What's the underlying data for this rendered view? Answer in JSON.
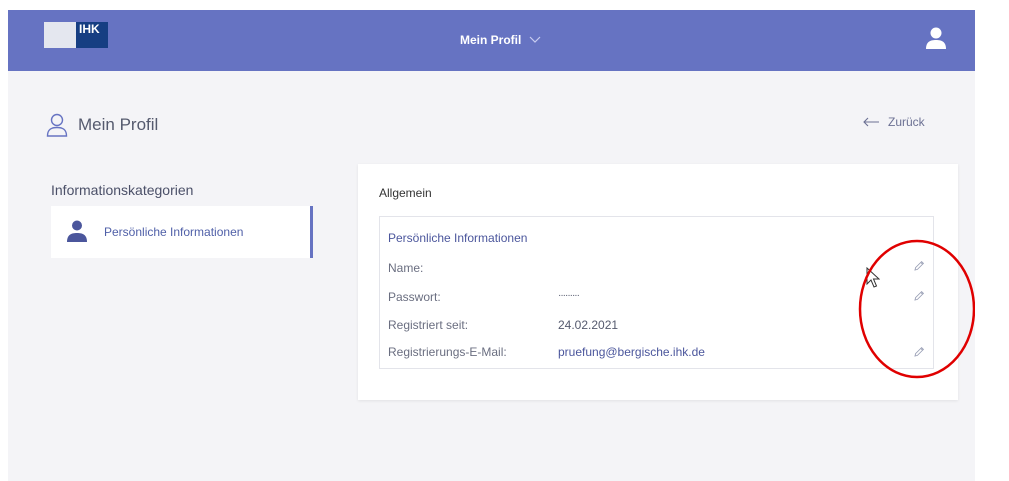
{
  "header": {
    "logo_text": "IHK",
    "nav_title": "Mein Profil"
  },
  "page": {
    "title": "Mein Profil",
    "back_label": "Zurück"
  },
  "sidebar": {
    "heading": "Informationskategorien",
    "items": [
      {
        "label": "Persönliche Informationen",
        "icon": "user-icon",
        "active": true
      }
    ]
  },
  "main": {
    "section_title": "Allgemein",
    "box_title": "Persönliche Informationen",
    "rows": [
      {
        "label": "Name:",
        "value": "",
        "editable": true
      },
      {
        "label": "Passwort:",
        "value": "·········",
        "editable": true
      },
      {
        "label": "Registriert seit:",
        "value": "24.02.2021",
        "editable": false
      },
      {
        "label": "Registrierungs-E-Mail:",
        "value": "pruefung@bergische.ihk.de",
        "editable": true
      }
    ]
  },
  "colors": {
    "header_bg": "#6673c2",
    "accent": "#4b569c",
    "annotation": "#e00000"
  }
}
